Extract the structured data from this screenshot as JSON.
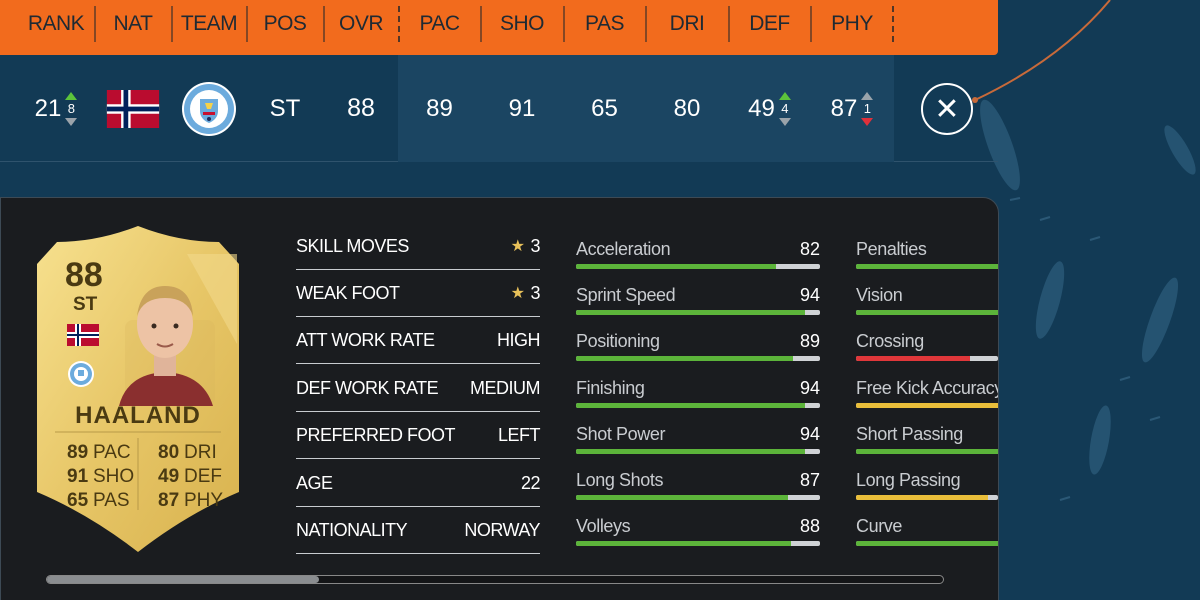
{
  "header": {
    "columns": [
      "RANK",
      "NAT",
      "TEAM",
      "POS",
      "OVR",
      "PAC",
      "SHO",
      "PAS",
      "DRI",
      "DEF",
      "PHY"
    ]
  },
  "player_row": {
    "rank": "21",
    "rank_change": "8",
    "rank_change_direction": "up",
    "nation_flag": "norway-flag-icon",
    "club_badge": "manchester-city-badge-icon",
    "club_badge_text": "MANCHESTER CITY",
    "position": "ST",
    "overall": "88",
    "stats": [
      {
        "key": "PAC",
        "value": "89",
        "change": "",
        "direction": ""
      },
      {
        "key": "SHO",
        "value": "91",
        "change": "",
        "direction": ""
      },
      {
        "key": "PAS",
        "value": "65",
        "change": "",
        "direction": ""
      },
      {
        "key": "DRI",
        "value": "80",
        "change": "",
        "direction": ""
      },
      {
        "key": "DEF",
        "value": "49",
        "change": "4",
        "direction": "up"
      },
      {
        "key": "PHY",
        "value": "87",
        "change": "1",
        "direction": "down"
      }
    ],
    "close_icon": "close-icon"
  },
  "card": {
    "rating": "88",
    "position": "ST",
    "name": "HAALAND",
    "left_stats": [
      {
        "value": "89",
        "label": "PAC"
      },
      {
        "value": "91",
        "label": "SHO"
      },
      {
        "value": "65",
        "label": "PAS"
      }
    ],
    "right_stats": [
      {
        "value": "80",
        "label": "DRI"
      },
      {
        "value": "49",
        "label": "DEF"
      },
      {
        "value": "87",
        "label": "PHY"
      }
    ]
  },
  "info": [
    {
      "label": "SKILL MOVES",
      "value": "3",
      "star": true
    },
    {
      "label": "WEAK FOOT",
      "value": "3",
      "star": true
    },
    {
      "label": "ATT WORK RATE",
      "value": "HIGH",
      "star": false
    },
    {
      "label": "DEF WORK RATE",
      "value": "MEDIUM",
      "star": false
    },
    {
      "label": "PREFERRED FOOT",
      "value": "LEFT",
      "star": false
    },
    {
      "label": "AGE",
      "value": "22",
      "star": false
    },
    {
      "label": "NATIONALITY",
      "value": "NORWAY",
      "star": false
    }
  ],
  "attributes_col1": [
    {
      "name": "Acceleration",
      "value": "82",
      "pct": 0.82
    },
    {
      "name": "Sprint Speed",
      "value": "94",
      "pct": 0.94
    },
    {
      "name": "Positioning",
      "value": "89",
      "pct": 0.89
    },
    {
      "name": "Finishing",
      "value": "94",
      "pct": 0.94
    },
    {
      "name": "Shot Power",
      "value": "94",
      "pct": 0.94
    },
    {
      "name": "Long Shots",
      "value": "87",
      "pct": 0.87
    },
    {
      "name": "Volleys",
      "value": "88",
      "pct": 0.88
    }
  ],
  "attributes_col2": [
    {
      "name": "Penalties",
      "value": "",
      "pct": 1
    },
    {
      "name": "Vision",
      "value": "",
      "pct": 1
    },
    {
      "name": "Crossing",
      "value": "",
      "pct": 0.8
    },
    {
      "name": "Free Kick Accuracy",
      "value": "",
      "pct": 1
    },
    {
      "name": "Short Passing",
      "value": "",
      "pct": 1
    },
    {
      "name": "Long Passing",
      "value": "",
      "pct": 0.93
    },
    {
      "name": "Curve",
      "value": "",
      "pct": 1
    }
  ],
  "colors": {
    "header_bg": "#f26b1d",
    "page_bg": "#123a55",
    "panel_bg": "#1a1c1f",
    "bar_green": "#5cb43a",
    "bar_red": "#e0373a",
    "bar_yellow": "#e9be3a",
    "arrow_up": "#5cc43b",
    "arrow_down": "#e0303a"
  },
  "col2_bar_colors": [
    "green",
    "green",
    "red",
    "yellow",
    "green",
    "yellow",
    "green"
  ],
  "scroll_position": 0.3
}
